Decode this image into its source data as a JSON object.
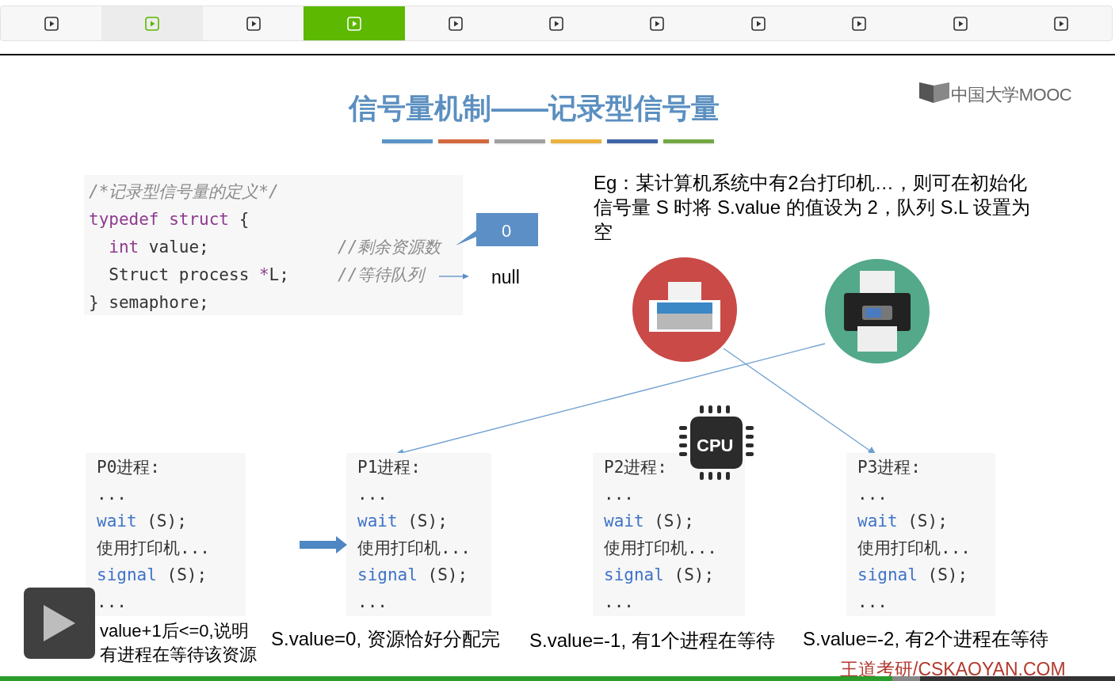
{
  "tabs": [
    {
      "selected": false,
      "highlighted": false
    },
    {
      "selected": false,
      "highlighted": true
    },
    {
      "selected": false,
      "highlighted": false
    },
    {
      "selected": true,
      "highlighted": false
    },
    {
      "selected": false,
      "highlighted": false
    },
    {
      "selected": false,
      "highlighted": false
    },
    {
      "selected": false,
      "highlighted": false
    },
    {
      "selected": false,
      "highlighted": false
    },
    {
      "selected": false,
      "highlighted": false
    },
    {
      "selected": false,
      "highlighted": false
    },
    {
      "selected": false,
      "highlighted": false
    }
  ],
  "slide": {
    "title": "信号量机制——记录型信号量",
    "logo": "中国大学MOOC",
    "title_bars": [
      {
        "color": "#5b94c9"
      },
      {
        "color": "#d2693f"
      },
      {
        "color": "#a0a0a0"
      },
      {
        "color": "#ebb23f"
      },
      {
        "color": "#3f64a8"
      },
      {
        "color": "#72a844"
      }
    ],
    "definition": [
      {
        "segments": [
          {
            "text": "/*记录型信号量的定义*/",
            "kind": "comment"
          }
        ]
      },
      {
        "segments": [
          {
            "text": "typedef struct",
            "kind": "keyword"
          },
          {
            "text": " {",
            "kind": "plain"
          }
        ]
      },
      {
        "segments": [
          {
            "text": "  int",
            "kind": "keyword"
          },
          {
            "text": " value;",
            "kind": "plain"
          }
        ],
        "comment": "//剩余资源数"
      },
      {
        "segments": [
          {
            "text": "  Struct process ",
            "kind": "plain"
          },
          {
            "text": "*",
            "kind": "keyword"
          },
          {
            "text": "L;",
            "kind": "plain"
          }
        ],
        "comment": "//等待队列"
      },
      {
        "segments": [
          {
            "text": "} semaphore;",
            "kind": "plain"
          }
        ]
      }
    ],
    "value_callout": "0",
    "queue_value": "null",
    "example": "Eg：某计算机系统中有2台打印机…，则可在初始化信号量 S 时将 S.value 的值设为 2，队列 S.L 设置为空",
    "cpu_label": "CPU",
    "processes": [
      {
        "lines": [
          [
            {
              "text": "P0进程:",
              "kind": "plain"
            }
          ],
          [
            {
              "text": "...",
              "kind": "plain"
            }
          ],
          [
            {
              "text": "wait",
              "kind": "func"
            },
            {
              "text": " (S);",
              "kind": "plain"
            }
          ],
          [
            {
              "text": "使用打印机...",
              "kind": "plain"
            }
          ],
          [
            {
              "text": "signal",
              "kind": "func"
            },
            {
              "text": " (S);",
              "kind": "plain"
            }
          ],
          [
            {
              "text": "...",
              "kind": "plain"
            }
          ]
        ],
        "pointer": false,
        "caption": [
          "value+1后<=0,说明",
          "有进程在等待该资源"
        ]
      },
      {
        "lines": [
          [
            {
              "text": "P1进程:",
              "kind": "plain"
            }
          ],
          [
            {
              "text": "...",
              "kind": "plain"
            }
          ],
          [
            {
              "text": "wait",
              "kind": "func"
            },
            {
              "text": " (S);",
              "kind": "plain"
            }
          ],
          [
            {
              "text": "使用打印机...",
              "kind": "plain"
            }
          ],
          [
            {
              "text": "signal",
              "kind": "func"
            },
            {
              "text": " (S);",
              "kind": "plain"
            }
          ],
          [
            {
              "text": "...",
              "kind": "plain"
            }
          ]
        ],
        "pointer": true,
        "caption": [
          "S.value=0, 资源恰好分配完"
        ]
      },
      {
        "lines": [
          [
            {
              "text": "P2进程:",
              "kind": "plain"
            }
          ],
          [
            {
              "text": "...",
              "kind": "plain"
            }
          ],
          [
            {
              "text": "wait",
              "kind": "func"
            },
            {
              "text": " (S);",
              "kind": "plain"
            }
          ],
          [
            {
              "text": "使用打印机...",
              "kind": "plain"
            }
          ],
          [
            {
              "text": "signal",
              "kind": "func"
            },
            {
              "text": " (S);",
              "kind": "plain"
            }
          ],
          [
            {
              "text": "...",
              "kind": "plain"
            }
          ]
        ],
        "pointer": false,
        "caption": [
          "S.value=-1, 有1个进程在等待"
        ]
      },
      {
        "lines": [
          [
            {
              "text": "P3进程:",
              "kind": "plain"
            }
          ],
          [
            {
              "text": "...",
              "kind": "plain"
            }
          ],
          [
            {
              "text": "wait",
              "kind": "func"
            },
            {
              "text": " (S);",
              "kind": "plain"
            }
          ],
          [
            {
              "text": "使用打印机...",
              "kind": "plain"
            }
          ],
          [
            {
              "text": "signal",
              "kind": "func"
            },
            {
              "text": " (S);",
              "kind": "plain"
            }
          ],
          [
            {
              "text": "...",
              "kind": "plain"
            }
          ]
        ],
        "pointer": false,
        "caption": [
          "S.value=-2, 有2个进程在等待"
        ]
      }
    ],
    "credit": "王道考研/CSKAOYAN.COM"
  },
  "progress": {
    "level": 0.8
  }
}
